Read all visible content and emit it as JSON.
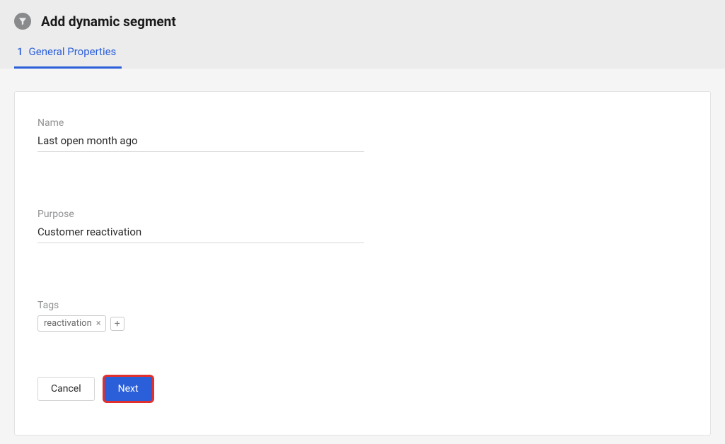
{
  "header": {
    "title": "Add dynamic segment"
  },
  "tabs": [
    {
      "number": "1",
      "label": "General Properties",
      "active": true
    }
  ],
  "form": {
    "name": {
      "label": "Name",
      "value": "Last open month ago"
    },
    "purpose": {
      "label": "Purpose",
      "value": "Customer reactivation"
    },
    "tags": {
      "label": "Tags",
      "items": [
        {
          "text": "reactivation"
        }
      ]
    }
  },
  "actions": {
    "cancel": "Cancel",
    "next": "Next"
  }
}
